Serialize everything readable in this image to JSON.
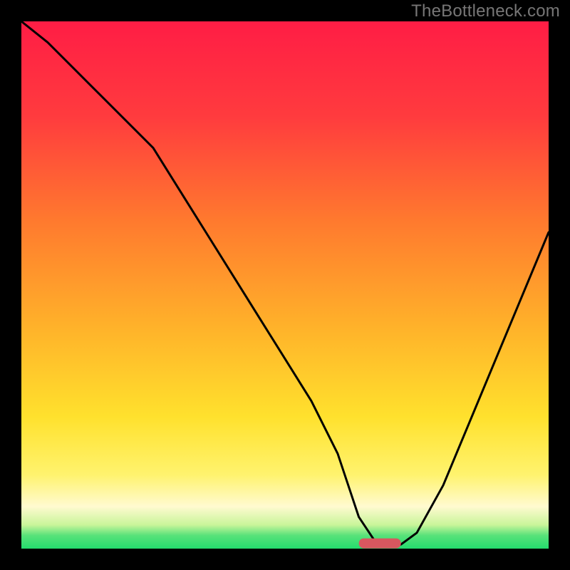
{
  "watermark": "TheBottleneck.com",
  "chart_data": {
    "type": "line",
    "title": "",
    "xlabel": "",
    "ylabel": "",
    "xlim": [
      0,
      100
    ],
    "ylim": [
      0,
      100
    ],
    "grid": false,
    "background": {
      "type": "vertical_gradient",
      "description": "smooth gradient filling plot area top→bottom: red → orange → yellow, with a thick pale-yellow band near the bottom and a thin green band at the very bottom",
      "stops": [
        {
          "offset": 0.0,
          "color": "#ff1d45"
        },
        {
          "offset": 0.18,
          "color": "#ff3b3e"
        },
        {
          "offset": 0.38,
          "color": "#ff7a2e"
        },
        {
          "offset": 0.58,
          "color": "#ffb22a"
        },
        {
          "offset": 0.75,
          "color": "#ffe12d"
        },
        {
          "offset": 0.86,
          "color": "#fff36e"
        },
        {
          "offset": 0.92,
          "color": "#fffad0"
        },
        {
          "offset": 0.955,
          "color": "#c9f59a"
        },
        {
          "offset": 0.975,
          "color": "#58e27a"
        },
        {
          "offset": 1.0,
          "color": "#24db6d"
        }
      ]
    },
    "series": [
      {
        "name": "bottleneck-curve",
        "color": "#000000",
        "stroke_width": 3,
        "x": [
          0,
          5,
          10,
          15,
          20,
          25,
          30,
          35,
          40,
          45,
          50,
          55,
          60,
          62,
          64,
          67,
          70,
          72,
          75,
          80,
          85,
          90,
          95,
          100
        ],
        "y": [
          100,
          96,
          91,
          86,
          81,
          76,
          68,
          60,
          52,
          44,
          36,
          28,
          18,
          12,
          6,
          1.5,
          0.5,
          0.8,
          3,
          12,
          24,
          36,
          48,
          60
        ]
      }
    ],
    "markers": [
      {
        "name": "optimal-range-marker",
        "shape": "rounded-rect",
        "x_center": 68,
        "y": 1,
        "width": 8,
        "color": "#d8575f"
      }
    ]
  }
}
